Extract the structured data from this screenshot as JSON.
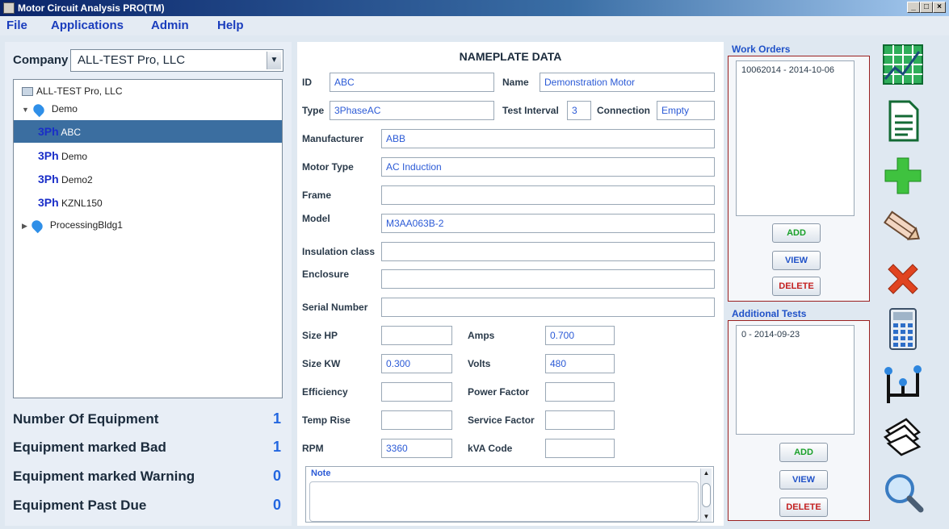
{
  "window": {
    "title": "Motor Circuit Analysis PRO(TM)"
  },
  "menu": {
    "file": "File",
    "applications": "Applications",
    "admin": "Admin",
    "help": "Help"
  },
  "left": {
    "company_label": "Company",
    "company_value": "ALL-TEST Pro, LLC",
    "tree": {
      "root": "ALL-TEST Pro, LLC",
      "demo": "Demo",
      "items": [
        {
          "prefix": "3Ph",
          "label": "ABC"
        },
        {
          "prefix": "3Ph",
          "label": "Demo"
        },
        {
          "prefix": "3Ph",
          "label": "Demo2"
        },
        {
          "prefix": "3Ph",
          "label": "KZNL150"
        }
      ],
      "processing": "ProcessingBldg1"
    },
    "stats": [
      {
        "label": "Number Of Equipment",
        "value": "1"
      },
      {
        "label": "Equipment marked Bad",
        "value": "1"
      },
      {
        "label": "Equipment marked Warning",
        "value": "0"
      },
      {
        "label": "Equipment Past Due",
        "value": "0"
      }
    ]
  },
  "nameplate": {
    "title": "NAMEPLATE DATA",
    "id_label": "ID",
    "id_value": "ABC",
    "name_label": "Name",
    "name_value": "Demonstration Motor",
    "type_label": "Type",
    "type_value": "3PhaseAC",
    "interval_label": "Test Interval",
    "interval_value": "3",
    "connection_label": "Connection",
    "connection_value": "Empty",
    "manufacturer_label": "Manufacturer",
    "manufacturer_value": "ABB",
    "motor_type_label": "Motor Type",
    "motor_type_value": "AC Induction",
    "frame_label": "Frame",
    "frame_value": "",
    "model_label": "Model",
    "model_value": "M3AA063B-2",
    "insulation_label": "Insulation class",
    "insulation_value": "",
    "enclosure_label": "Enclosure",
    "enclosure_value": "",
    "serial_label": "Serial Number",
    "serial_value": "",
    "size_hp_label": "Size HP",
    "size_hp_value": "",
    "amps_label": "Amps",
    "amps_value": "0.700",
    "size_kw_label": "Size KW",
    "size_kw_value": "0.300",
    "volts_label": "Volts",
    "volts_value": "480",
    "efficiency_label": "Efficiency",
    "efficiency_value": "",
    "power_factor_label": "Power Factor",
    "power_factor_value": "",
    "temp_rise_label": "Temp Rise",
    "temp_rise_value": "",
    "service_factor_label": "Service Factor",
    "service_factor_value": "",
    "rpm_label": "RPM",
    "rpm_value": "3360",
    "kva_label": "kVA Code",
    "kva_value": "",
    "note_label": "Note"
  },
  "work_orders": {
    "title": "Work Orders",
    "items": [
      "10062014 - 2014-10-06"
    ],
    "add": "ADD",
    "view": "VIEW",
    "delete": "DELETE"
  },
  "additional_tests": {
    "title": "Additional Tests",
    "items": [
      "0 - 2014-09-23"
    ],
    "add": "ADD",
    "view": "VIEW",
    "delete": "DELETE"
  },
  "toolbar": {
    "icons": [
      "grid-chart-icon",
      "document-icon",
      "add-icon",
      "edit-pencil-icon",
      "delete-icon",
      "calculator-icon",
      "hierarchy-icon",
      "documents-stack-icon",
      "search-icon"
    ]
  },
  "colors": {
    "accent": "#2052c8",
    "selected": "#3b6ea0",
    "add": "#1aa02a",
    "delete": "#c42020"
  }
}
